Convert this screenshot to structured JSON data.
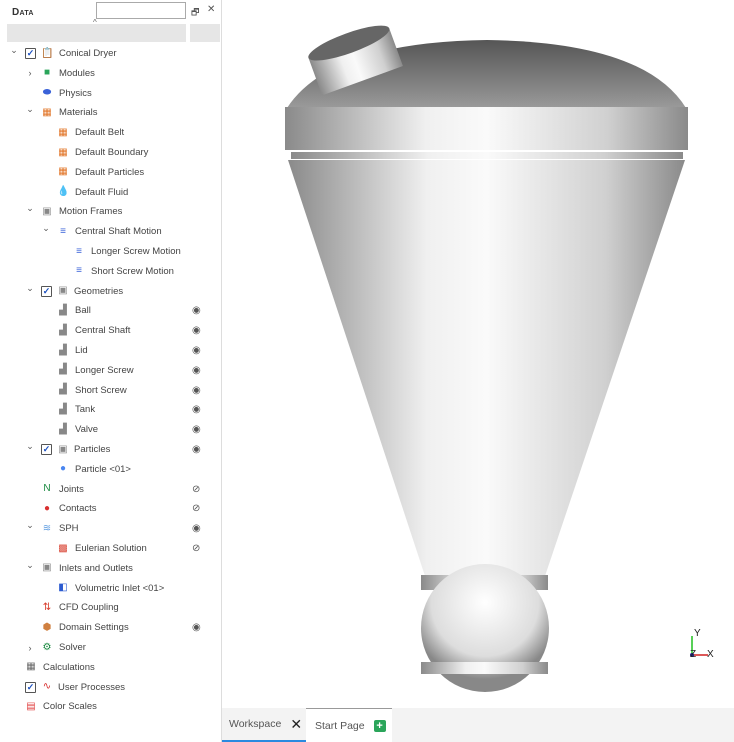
{
  "panel": {
    "title": "Data",
    "search_placeholder": "",
    "float": "🗗",
    "close": "✕",
    "sort": "^"
  },
  "tree": [
    {
      "label": "Conical Dryer",
      "level": 0,
      "arrow": "down",
      "checkbox": true,
      "icon": "clipboard-icon",
      "glyph": "📋",
      "color": "#666"
    },
    {
      "label": "Modules",
      "level": 1,
      "arrow": "right",
      "icon": "modules-icon",
      "glyph": "■",
      "color": "#2aa55a"
    },
    {
      "label": "Physics",
      "level": 1,
      "icon": "physics-icon",
      "glyph": "⬬",
      "color": "#3a62d8"
    },
    {
      "label": "Materials",
      "level": 1,
      "arrow": "down",
      "icon": "materials-icon",
      "glyph": "▦",
      "color": "#e07020"
    },
    {
      "label": "Default Belt",
      "level": 2,
      "icon": "material-icon",
      "glyph": "▦",
      "color": "#e07020"
    },
    {
      "label": "Default Boundary",
      "level": 2,
      "icon": "material-icon",
      "glyph": "▦",
      "color": "#e07020"
    },
    {
      "label": "Default Particles",
      "level": 2,
      "icon": "material-icon",
      "glyph": "▦",
      "color": "#e07020"
    },
    {
      "label": "Default Fluid",
      "level": 2,
      "icon": "fluid-icon",
      "glyph": "💧",
      "color": "#2a6ae0"
    },
    {
      "label": "Motion Frames",
      "level": 1,
      "arrow": "down",
      "icon": "motion-frames-icon",
      "glyph": "▣",
      "color": "#888"
    },
    {
      "label": "Central Shaft Motion",
      "level": 2,
      "arrow": "down",
      "icon": "motion-icon",
      "glyph": "≡",
      "color": "#3a62d8"
    },
    {
      "label": "Longer Screw Motion",
      "level": 3,
      "icon": "motion-icon",
      "glyph": "≡",
      "color": "#3a62d8"
    },
    {
      "label": "Short Screw Motion",
      "level": 3,
      "icon": "motion-icon",
      "glyph": "≡",
      "color": "#3a62d8"
    },
    {
      "label": "Geometries",
      "level": 1,
      "arrow": "down",
      "checkbox": true,
      "icon": "geometries-icon",
      "glyph": "▣",
      "color": "#888"
    },
    {
      "label": "Ball",
      "level": 2,
      "icon": "geometry-icon",
      "glyph": "▟",
      "color": "#888",
      "eye": "visible"
    },
    {
      "label": "Central Shaft",
      "level": 2,
      "icon": "geometry-icon",
      "glyph": "▟",
      "color": "#888",
      "eye": "visible"
    },
    {
      "label": "Lid",
      "level": 2,
      "icon": "geometry-icon",
      "glyph": "▟",
      "color": "#888",
      "eye": "visible"
    },
    {
      "label": "Longer Screw",
      "level": 2,
      "icon": "geometry-icon",
      "glyph": "▟",
      "color": "#888",
      "eye": "visible"
    },
    {
      "label": "Short Screw",
      "level": 2,
      "icon": "geometry-icon",
      "glyph": "▟",
      "color": "#888",
      "eye": "visible"
    },
    {
      "label": "Tank",
      "level": 2,
      "icon": "geometry-icon",
      "glyph": "▟",
      "color": "#888",
      "eye": "visible"
    },
    {
      "label": "Valve",
      "level": 2,
      "icon": "geometry-icon",
      "glyph": "▟",
      "color": "#888",
      "eye": "visible"
    },
    {
      "label": "Particles",
      "level": 1,
      "arrow": "down",
      "checkbox": true,
      "icon": "particles-icon",
      "glyph": "▣",
      "color": "#888",
      "eye": "visible"
    },
    {
      "label": "Particle <01>",
      "level": 2,
      "icon": "particle-icon",
      "glyph": "●",
      "color": "#4a86f0"
    },
    {
      "label": "Joints",
      "level": 1,
      "icon": "joints-icon",
      "glyph": "N",
      "color": "#1a8a40",
      "eye": "hidden"
    },
    {
      "label": "Contacts",
      "level": 1,
      "icon": "contacts-icon",
      "glyph": "●",
      "color": "#d83030",
      "eye": "hidden"
    },
    {
      "label": "SPH",
      "level": 1,
      "arrow": "down",
      "icon": "sph-icon",
      "glyph": "≋",
      "color": "#5a9ae0",
      "eye": "visible"
    },
    {
      "label": "Eulerian Solution",
      "level": 2,
      "icon": "eulerian-icon",
      "glyph": "▩",
      "color": "#d84030",
      "eye": "hidden"
    },
    {
      "label": "Inlets and Outlets",
      "level": 1,
      "arrow": "down",
      "icon": "inlets-icon",
      "glyph": "▣",
      "color": "#888"
    },
    {
      "label": "Volumetric Inlet <01>",
      "level": 2,
      "icon": "inlet-icon",
      "glyph": "◧",
      "color": "#2a5ad0"
    },
    {
      "label": "CFD Coupling",
      "level": 1,
      "icon": "cfd-coupling-icon",
      "glyph": "⇅",
      "color": "#d84030"
    },
    {
      "label": "Domain Settings",
      "level": 1,
      "icon": "domain-settings-icon",
      "glyph": "⬢",
      "color": "#d08040",
      "eye": "visible"
    },
    {
      "label": "Solver",
      "level": 1,
      "arrow": "right",
      "icon": "solver-icon",
      "glyph": "⚙",
      "color": "#1a8a40"
    },
    {
      "label": "Calculations",
      "level": 0,
      "icon": "calculations-icon",
      "glyph": "▦",
      "color": "#666"
    },
    {
      "label": "User Processes",
      "level": 0,
      "checkbox": true,
      "icon": "user-processes-icon",
      "glyph": "∿",
      "color": "#d83030"
    },
    {
      "label": "Color Scales",
      "level": 0,
      "icon": "color-scales-icon",
      "glyph": "▤",
      "color": "#e04040"
    }
  ],
  "tabs": [
    {
      "label": "Workspace",
      "active": true
    },
    {
      "label": "Start Page"
    }
  ],
  "axes": {
    "y": "Y",
    "x": "X",
    "z": "Z"
  },
  "colors": {
    "accent": "#2a8ae0",
    "add": "#2aa55a"
  }
}
